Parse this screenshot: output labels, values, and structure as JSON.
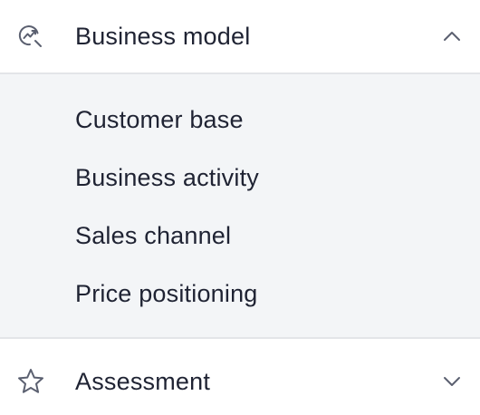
{
  "sections": [
    {
      "label": "Business model",
      "icon": "chart-search-icon",
      "expanded": true,
      "chevron": "chevron-up-icon",
      "items": [
        {
          "label": "Customer base"
        },
        {
          "label": "Business activity"
        },
        {
          "label": "Sales channel"
        },
        {
          "label": "Price positioning"
        }
      ]
    },
    {
      "label": "Assessment",
      "icon": "star-icon",
      "expanded": false,
      "chevron": "chevron-down-icon"
    }
  ],
  "colors": {
    "text": "#1f2333",
    "icon": "#5b6070",
    "submenu_bg": "#f3f5f7",
    "divider": "#e3e5e8"
  }
}
